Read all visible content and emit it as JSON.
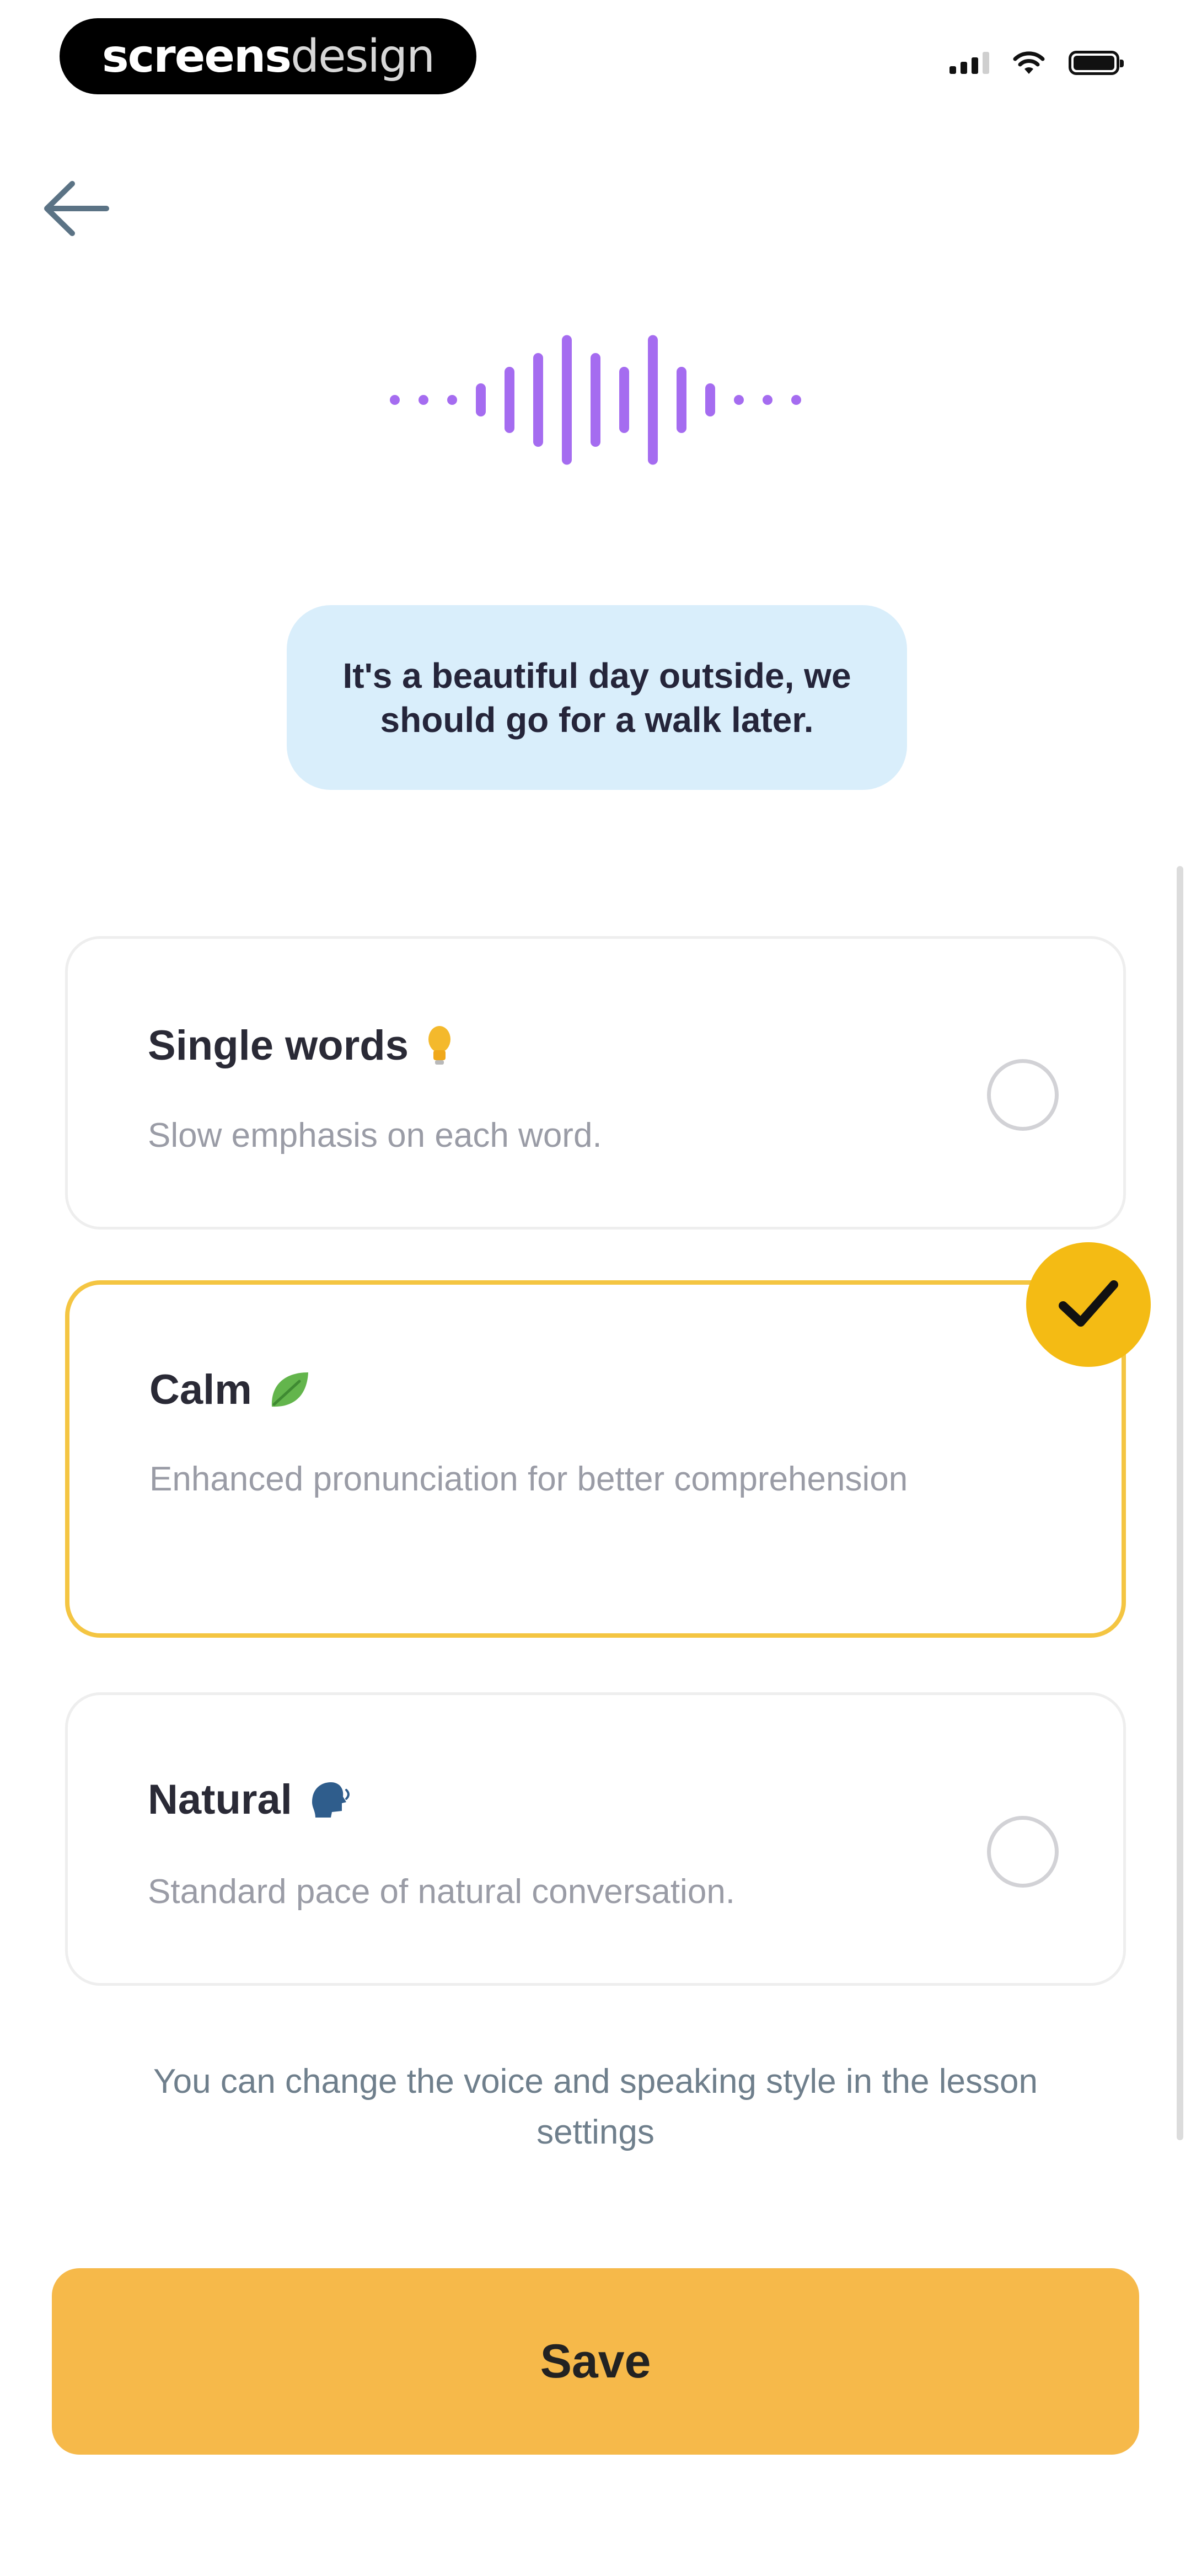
{
  "status_bar": {
    "brand_bold": "screens",
    "brand_light": "design"
  },
  "bubble": {
    "text": "It's a beautiful day outside, we should go for a walk later."
  },
  "options": [
    {
      "title": "Single words",
      "emoji_icon": "lightbulb-icon",
      "description": "Slow emphasis on each word.",
      "selected": false
    },
    {
      "title": "Calm",
      "emoji_icon": "leaf-icon",
      "description": "Enhanced pronunciation for better comprehension",
      "selected": true
    },
    {
      "title": "Natural",
      "emoji_icon": "speaking-head-icon",
      "description": "Standard pace of natural conversation.",
      "selected": false
    }
  ],
  "hint": "You can change the voice and speaking style in the lesson settings",
  "save_label": "Save",
  "colors": {
    "accent_yellow": "#f4bb14",
    "save_button": "#f6b94a",
    "waveform_purple": "#a56cf0",
    "bubble_background": "#d9eefb",
    "selected_border": "#f4c542"
  }
}
